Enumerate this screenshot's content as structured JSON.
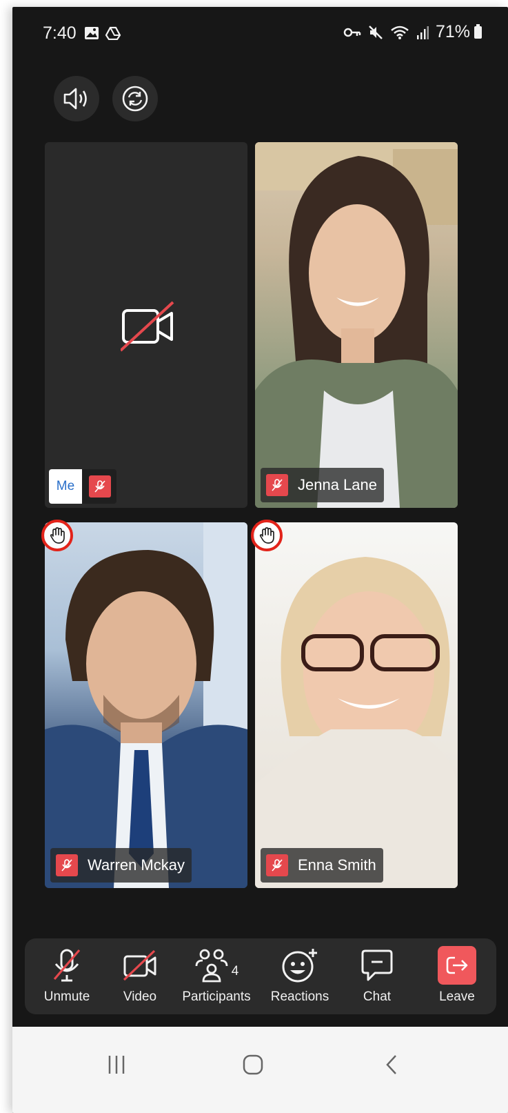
{
  "status_bar": {
    "time": "7:40",
    "battery": "71%",
    "icons": [
      "image-icon",
      "drive-icon",
      "vpn-key-icon",
      "mute-icon",
      "wifi-icon",
      "signal-icon",
      "battery-icon"
    ]
  },
  "top_controls": {
    "speaker_icon": "speaker-icon",
    "switch_camera_icon": "switch-camera-icon"
  },
  "tiles": [
    {
      "name": "Me",
      "muted": true,
      "camera_off": true,
      "hand_raised": false
    },
    {
      "name": "Jenna Lane",
      "muted": true,
      "camera_off": false,
      "hand_raised": false
    },
    {
      "name": "Warren Mckay",
      "muted": true,
      "camera_off": false,
      "hand_raised": true
    },
    {
      "name": "Enna Smith",
      "muted": true,
      "camera_off": false,
      "hand_raised": true
    }
  ],
  "toolbar": {
    "unmute": "Unmute",
    "video": "Video",
    "participants": "Participants",
    "participants_count": "4",
    "reactions": "Reactions",
    "chat": "Chat",
    "leave": "Leave"
  },
  "colors": {
    "background": "#171717",
    "mute_badge": "#e5484d",
    "leave": "#f0585c",
    "hand_ring": "#e2231a"
  }
}
